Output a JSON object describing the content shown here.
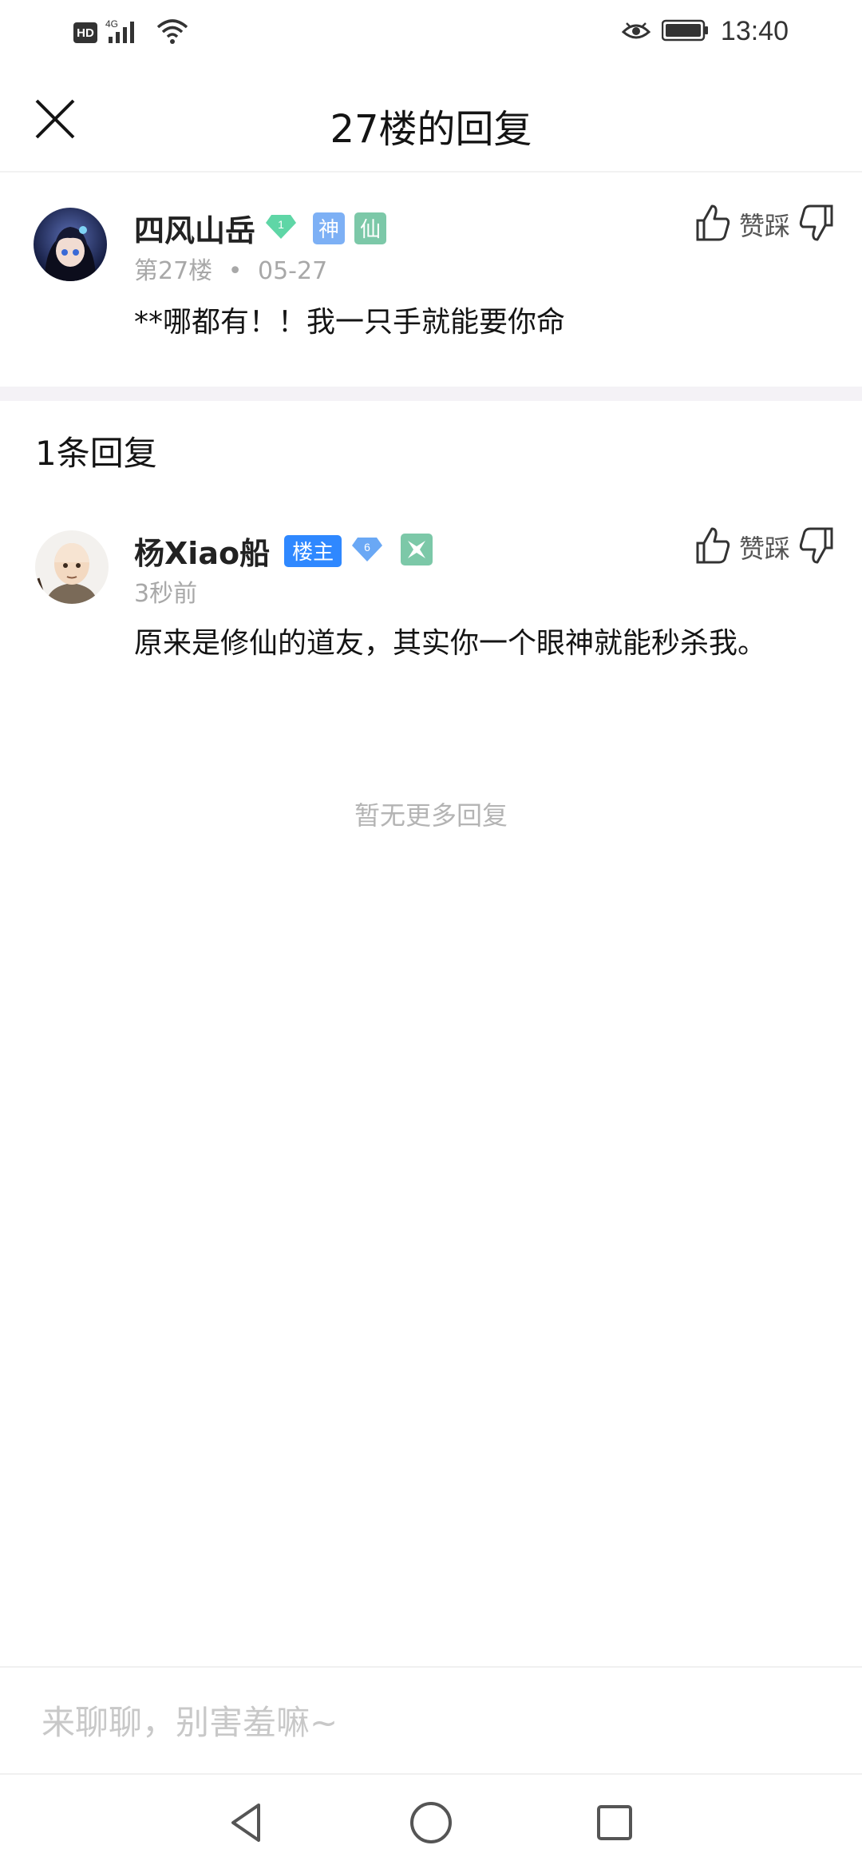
{
  "status_bar": {
    "hd": "HD",
    "network": "4G",
    "time": "13:40",
    "icons": [
      "signal-icon",
      "wifi-icon",
      "eye-icon",
      "battery-icon"
    ]
  },
  "header": {
    "title": "27楼的回复",
    "close_icon": "close-icon"
  },
  "post": {
    "username": "四风山岳",
    "level": "1",
    "tags": [
      "神",
      "仙"
    ],
    "floor": "第27楼",
    "separator": "•",
    "date": "05-27",
    "content": "**哪都有！！我一只手就能要你命",
    "vote_label": "赞踩"
  },
  "replies": {
    "count_label": "1条回复",
    "items": [
      {
        "username": "杨Xiao船",
        "owner_badge": "楼主",
        "level": "6",
        "time": "3秒前",
        "content": "原来是修仙的道友，其实你一个眼神就能秒杀我。",
        "vote_label": "赞踩"
      }
    ],
    "no_more": "暂无更多回复"
  },
  "comment": {
    "placeholder": "来聊聊，别害羞嘛~"
  },
  "nav": {
    "icons": [
      "back-icon",
      "home-icon",
      "recents-icon"
    ]
  },
  "colors": {
    "accent_blue": "#2f88ff",
    "level_green": "#5fd6a6",
    "level_blue": "#6aa8f5",
    "tag_blue": "#7db0f5",
    "tag_green": "#7cc8a8",
    "muted": "#a8a8a8"
  }
}
